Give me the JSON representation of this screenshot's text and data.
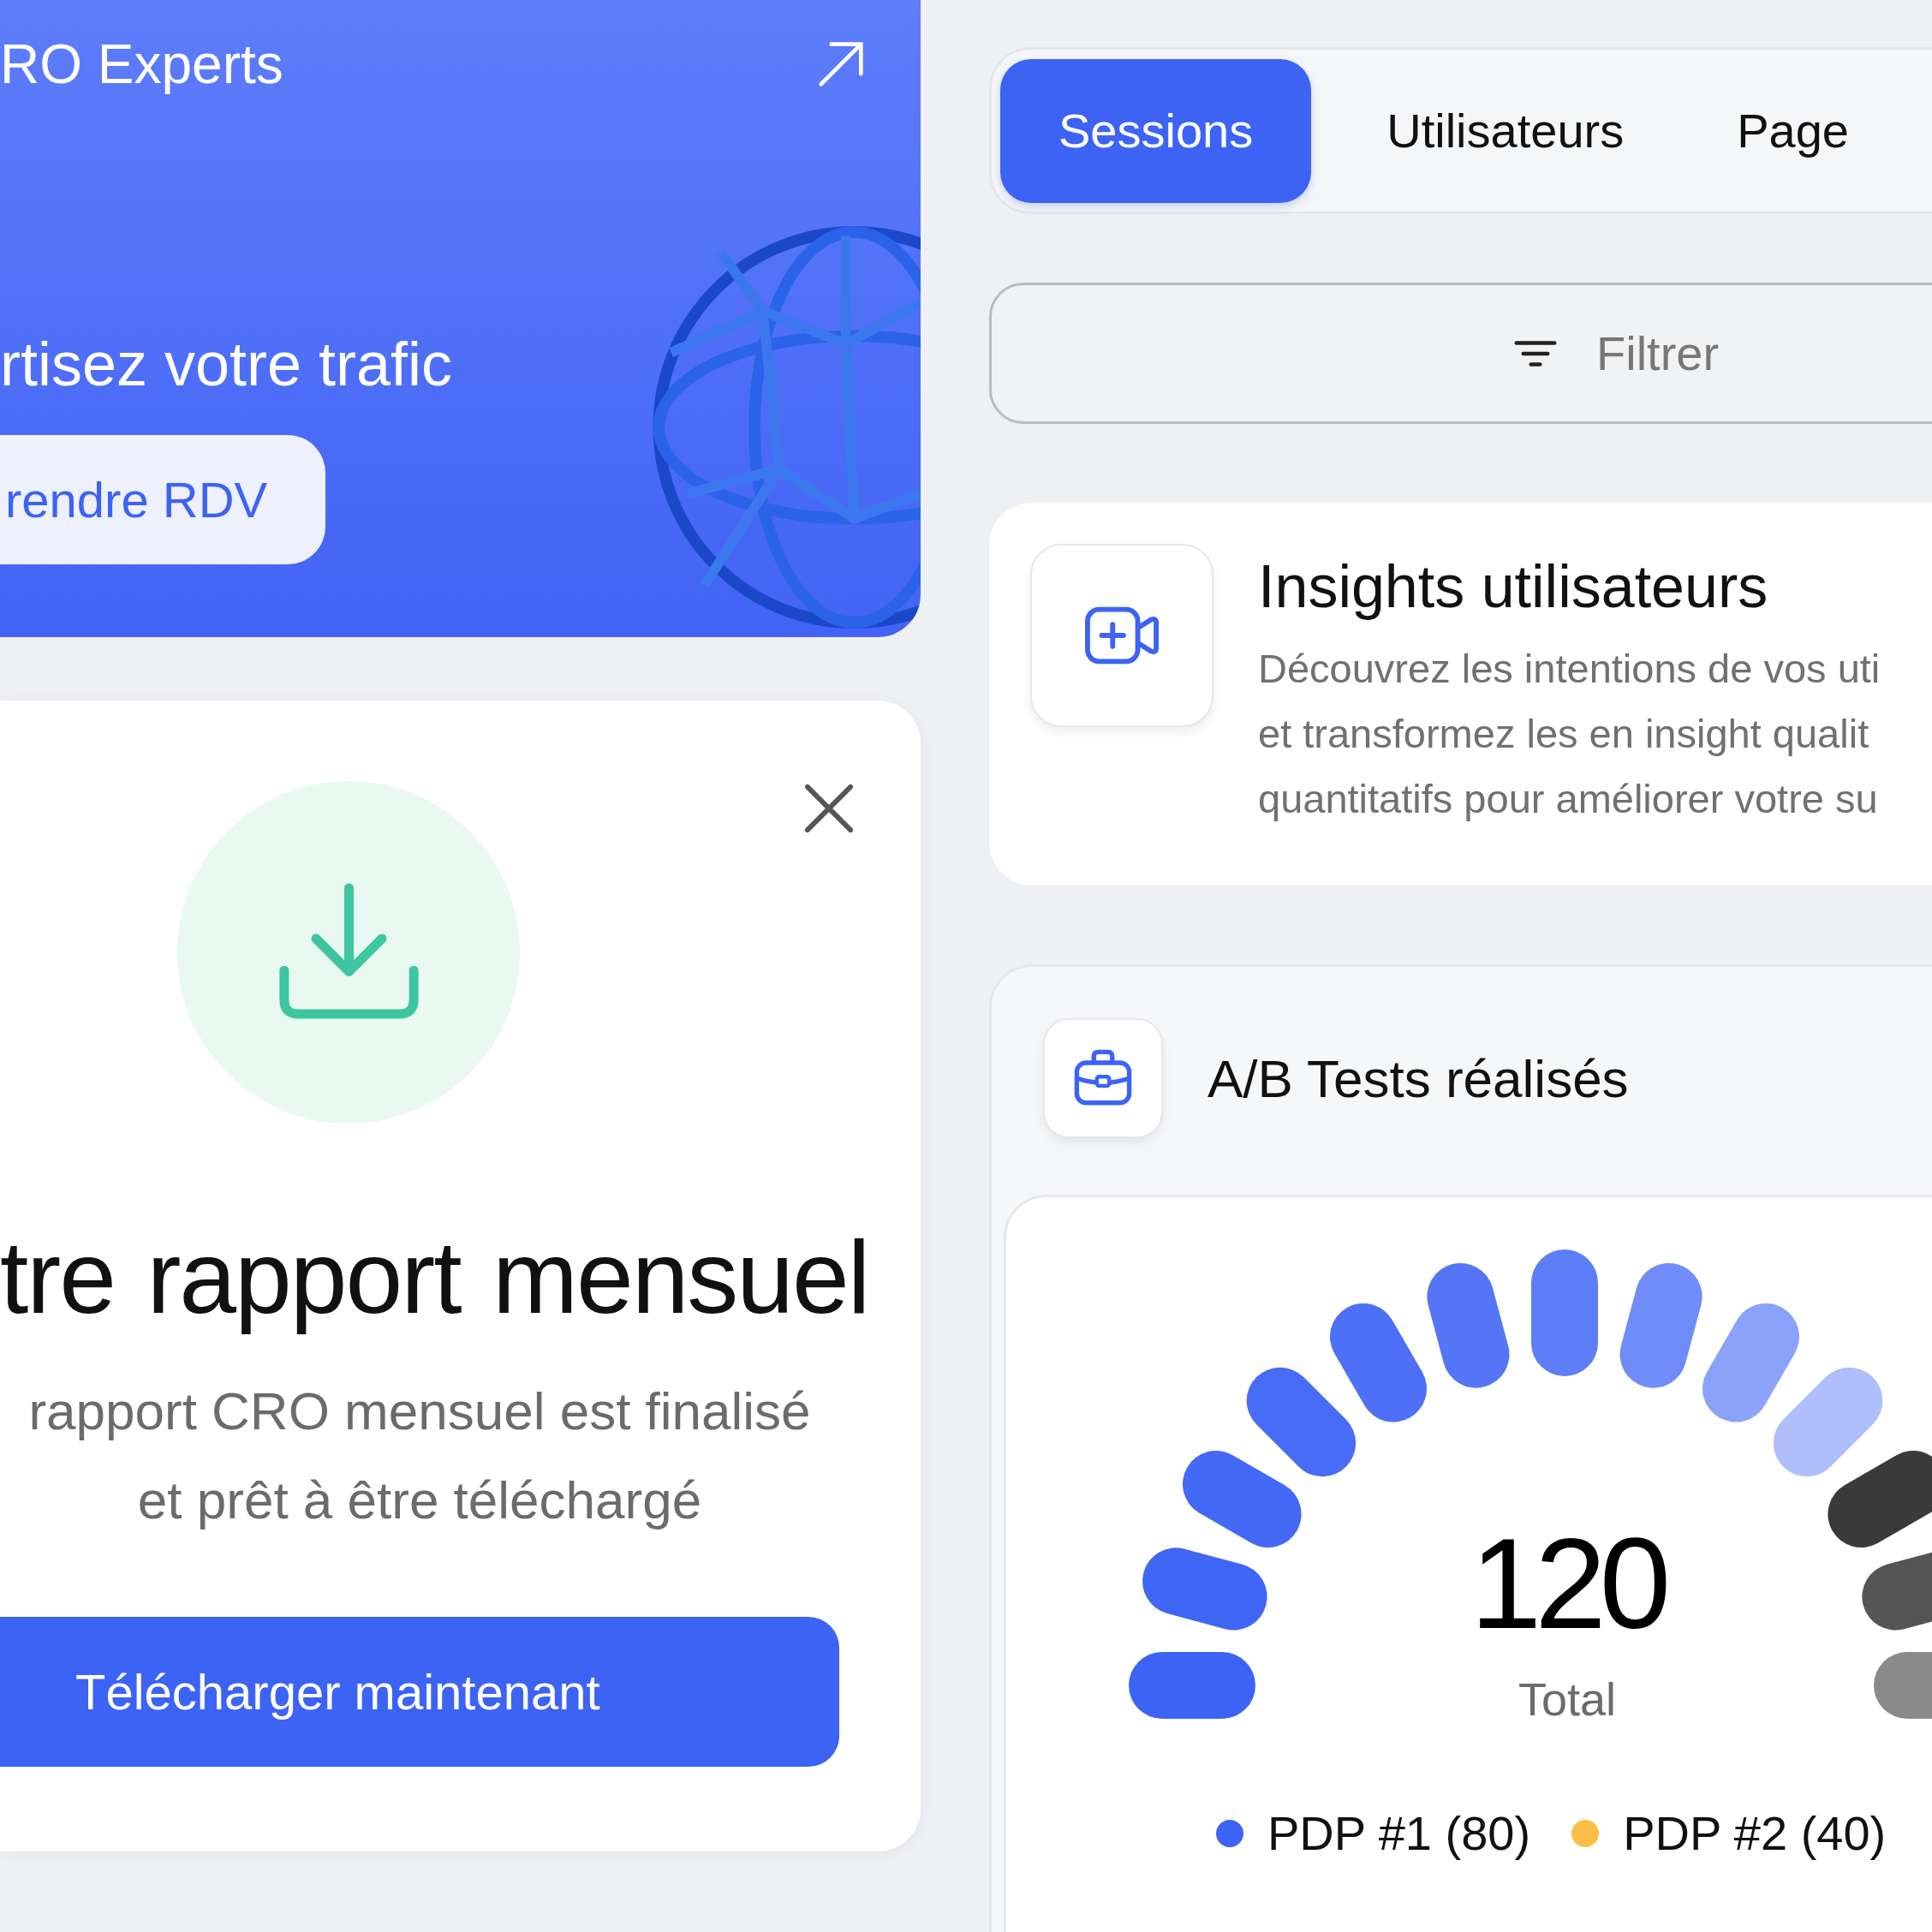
{
  "promo_card": {
    "title": "RO Experts",
    "headline": "rtisez votre trafic",
    "button": "rendre RDV"
  },
  "report_modal": {
    "title": "tre rapport mensuel",
    "message_lines": [
      "rapport CRO mensuel est finalisé",
      "et prêt à être téléchargé"
    ],
    "button": "Télécharger maintenant"
  },
  "tabs": [
    {
      "label": "Sessions",
      "selected": true
    },
    {
      "label": "Utilisateurs",
      "selected": false
    },
    {
      "label": "Page",
      "selected": false
    }
  ],
  "filter": {
    "label": "Filtrer"
  },
  "insights_card": {
    "title": "Insights utilisateurs",
    "description_lines": [
      "Découvrez les intentions de vos uti",
      "et transformez les en insight qualit",
      "quantitatifs pour améliorer votre su"
    ]
  },
  "ab_tests_card": {
    "title": "A/B Tests réalisés",
    "total": "120",
    "total_label": "Total",
    "legend": [
      {
        "label": "PDP #1 (80)",
        "color": "#3d63f5"
      },
      {
        "label": "PDP #2 (40)",
        "color": "#fbbf47"
      }
    ]
  }
}
